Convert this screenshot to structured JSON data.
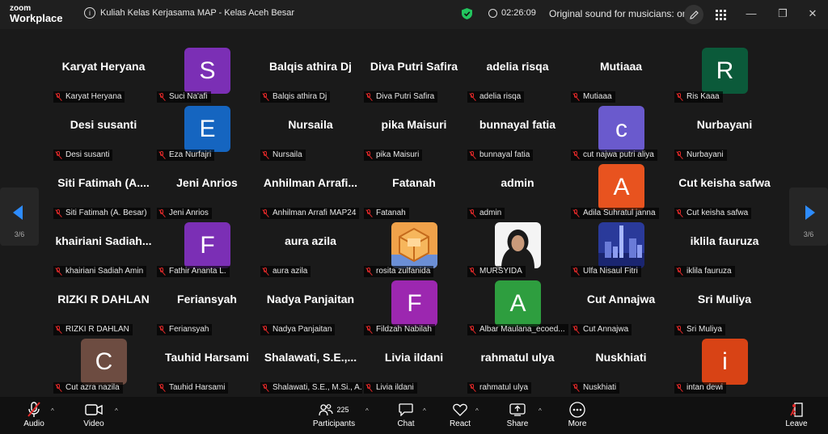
{
  "titlebar": {
    "logo_top": "zoom",
    "logo_bottom": "Workplace",
    "meeting_title": "Kuliah Kelas Kerjasama MAP - Kelas Aceh Besar",
    "timer": "02:26:09",
    "sound_status": "Original sound for musicians: on"
  },
  "gallery": {
    "page_left": "3/6",
    "page_right": "3/6",
    "tiles": [
      {
        "big": "Karyat Heryana",
        "label": "Karyat Heryana"
      },
      {
        "avatar": "S",
        "color": "#7b2fb5",
        "label": "Suci Na'afi"
      },
      {
        "big": "Balqis athira Dj",
        "label": "Balqis athira Dj"
      },
      {
        "big": "Diva Putri Safira",
        "label": "Diva Putri Safira"
      },
      {
        "big": "adelia risqa",
        "label": "adelia risqa"
      },
      {
        "big": "Mutiaaa",
        "label": "Mutiaaa"
      },
      {
        "avatar": "R",
        "color": "#0b5a3a",
        "label": "Ris Kaaa"
      },
      {
        "big": "Desi susanti",
        "label": "Desi susanti"
      },
      {
        "avatar": "E",
        "color": "#1565c0",
        "label": "Eza Nurfajri"
      },
      {
        "big": "Nursaila",
        "label": "Nursaila"
      },
      {
        "big": "pika Maisuri",
        "label": "pika Maisuri"
      },
      {
        "big": "bunnayal fatia",
        "label": "bunnayal fatia"
      },
      {
        "avatar": "c",
        "color": "#6a5acd",
        "label": "cut najwa putri aliya"
      },
      {
        "big": "Nurbayani",
        "label": "Nurbayani"
      },
      {
        "big": "Siti Fatimah (A....",
        "label": "Siti Fatimah (A. Besar)"
      },
      {
        "big": "Jeni Anrios",
        "label": "Jeni Anrios"
      },
      {
        "big": "Anhilman Arrafi...",
        "label": "Anhilman Arrafi MAP24"
      },
      {
        "big": "Fatanah",
        "label": "Fatanah"
      },
      {
        "big": "admin",
        "label": "admin"
      },
      {
        "avatar": "A",
        "color": "#e8531f",
        "label": "Adila Suhratul janna"
      },
      {
        "big": "Cut keisha safwa",
        "label": "Cut keisha safwa"
      },
      {
        "big": "khairiani Sadiah...",
        "label": "khairiani Sadiah Amin"
      },
      {
        "avatar": "F",
        "color": "#7b2fb5",
        "label": "Fathir Ananta L."
      },
      {
        "big": "aura azila",
        "label": "aura azila"
      },
      {
        "photo": "orange-cube",
        "label": "rosita zulfanida"
      },
      {
        "photo": "person",
        "label": "MURSYIDA"
      },
      {
        "photo": "city",
        "label": "Ulfa Nisaul Fitri"
      },
      {
        "big": "iklila fauruza",
        "label": "iklila fauruza"
      },
      {
        "big": "RIZKI R DAHLAN",
        "label": "RIZKI R DAHLAN"
      },
      {
        "big": "Feriansyah",
        "label": "Feriansyah"
      },
      {
        "big": "Nadya Panjaitan",
        "label": "Nadya Panjaitan"
      },
      {
        "avatar": "F",
        "color": "#9c27b0",
        "label": "Fildzah Nabilah"
      },
      {
        "avatar": "A",
        "color": "#2e9e3f",
        "label": "Albar Maulana_ecoed..."
      },
      {
        "big": "Cut Annajwa",
        "label": "Cut Annajwa"
      },
      {
        "big": "Sri Muliya",
        "label": "Sri Muliya"
      },
      {
        "avatar": "C",
        "color": "#6d4c41",
        "label": "Cut azra nazila"
      },
      {
        "big": "Tauhid Harsami",
        "label": "Tauhid Harsami"
      },
      {
        "big": "Shalawati, S.E.,...",
        "label": "Shalawati, S.E., M.Si., A..."
      },
      {
        "big": "Livia ildani",
        "label": "Livia ildani"
      },
      {
        "big": "rahmatul ulya",
        "label": "rahmatul ulya"
      },
      {
        "big": "Nuskhiati",
        "label": "Nuskhiati"
      },
      {
        "avatar": "i",
        "color": "#d84315",
        "label": "intan dewi"
      }
    ]
  },
  "toolbar": {
    "audio": "Audio",
    "video": "Video",
    "participants": "Participants",
    "participants_count": "225",
    "chat": "Chat",
    "react": "React",
    "share": "Share",
    "more": "More",
    "leave": "Leave"
  }
}
